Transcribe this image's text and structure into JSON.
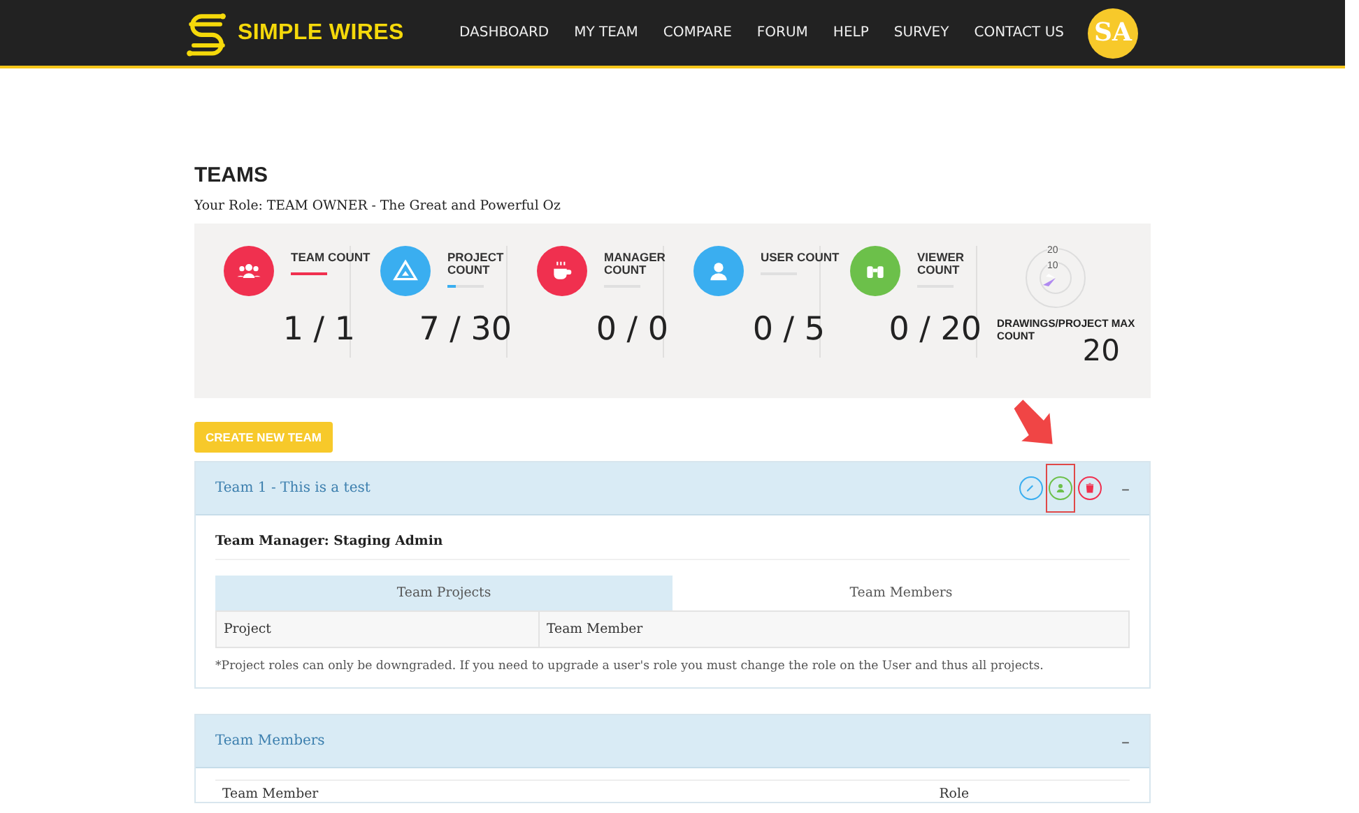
{
  "header": {
    "brand": "SIMPLE WIRES",
    "nav": [
      {
        "label": "DASHBOARD"
      },
      {
        "label": "MY TEAM"
      },
      {
        "label": "COMPARE"
      },
      {
        "label": "FORUM"
      },
      {
        "label": "HELP"
      },
      {
        "label": "SURVEY"
      },
      {
        "label": "CONTACT US"
      }
    ],
    "avatar": "SA"
  },
  "page": {
    "title": "TEAMS",
    "role": "Your Role: TEAM OWNER - The Great and Powerful Oz"
  },
  "stats": [
    {
      "kind": "team",
      "label": "TEAM COUNT",
      "value": "1 / 1",
      "level": 1,
      "color": "#f0304f"
    },
    {
      "kind": "project",
      "label": "PROJECT COUNT",
      "value": "7 / 30",
      "level": 0.23,
      "color": "#3aaef0"
    },
    {
      "kind": "manager",
      "label": "MANAGER COUNT",
      "value": "0 / 0",
      "level": 0,
      "color": "#f0304f"
    },
    {
      "kind": "user",
      "label": "USER COUNT",
      "value": "0 / 5",
      "level": 0,
      "color": "#3aaef0"
    },
    {
      "kind": "viewer",
      "label": "VIEWER COUNT",
      "value": "0 / 20",
      "level": 0,
      "color": "#6cc04a"
    }
  ],
  "gauge": {
    "ring_labels": [
      "20",
      "10"
    ],
    "label": "DRAWINGS/PROJECT MAX COUNT",
    "value": "20"
  },
  "create_button": "CREATE NEW TEAM",
  "team_panel": {
    "title": "Team 1 - This is a test",
    "toggle": "–",
    "expanded": true,
    "actions": [
      {
        "kind": "edit",
        "highlighted": false
      },
      {
        "kind": "add-user",
        "highlighted": true
      },
      {
        "kind": "delete",
        "highlighted": false
      }
    ],
    "manager": "Team Manager: Staging Admin",
    "tabs": [
      {
        "label": "Team Projects",
        "selected": true
      },
      {
        "label": "Team Members",
        "selected": false
      }
    ],
    "columns": [
      "Project",
      "Team Member"
    ],
    "note": "*Project roles can only be downgraded. If you need to upgrade a user's role you must change the role on the User and thus all projects."
  },
  "members_panel": {
    "title": "Team Members",
    "toggle": "–",
    "expanded": true,
    "columns": [
      "Team Member",
      "Role"
    ]
  }
}
